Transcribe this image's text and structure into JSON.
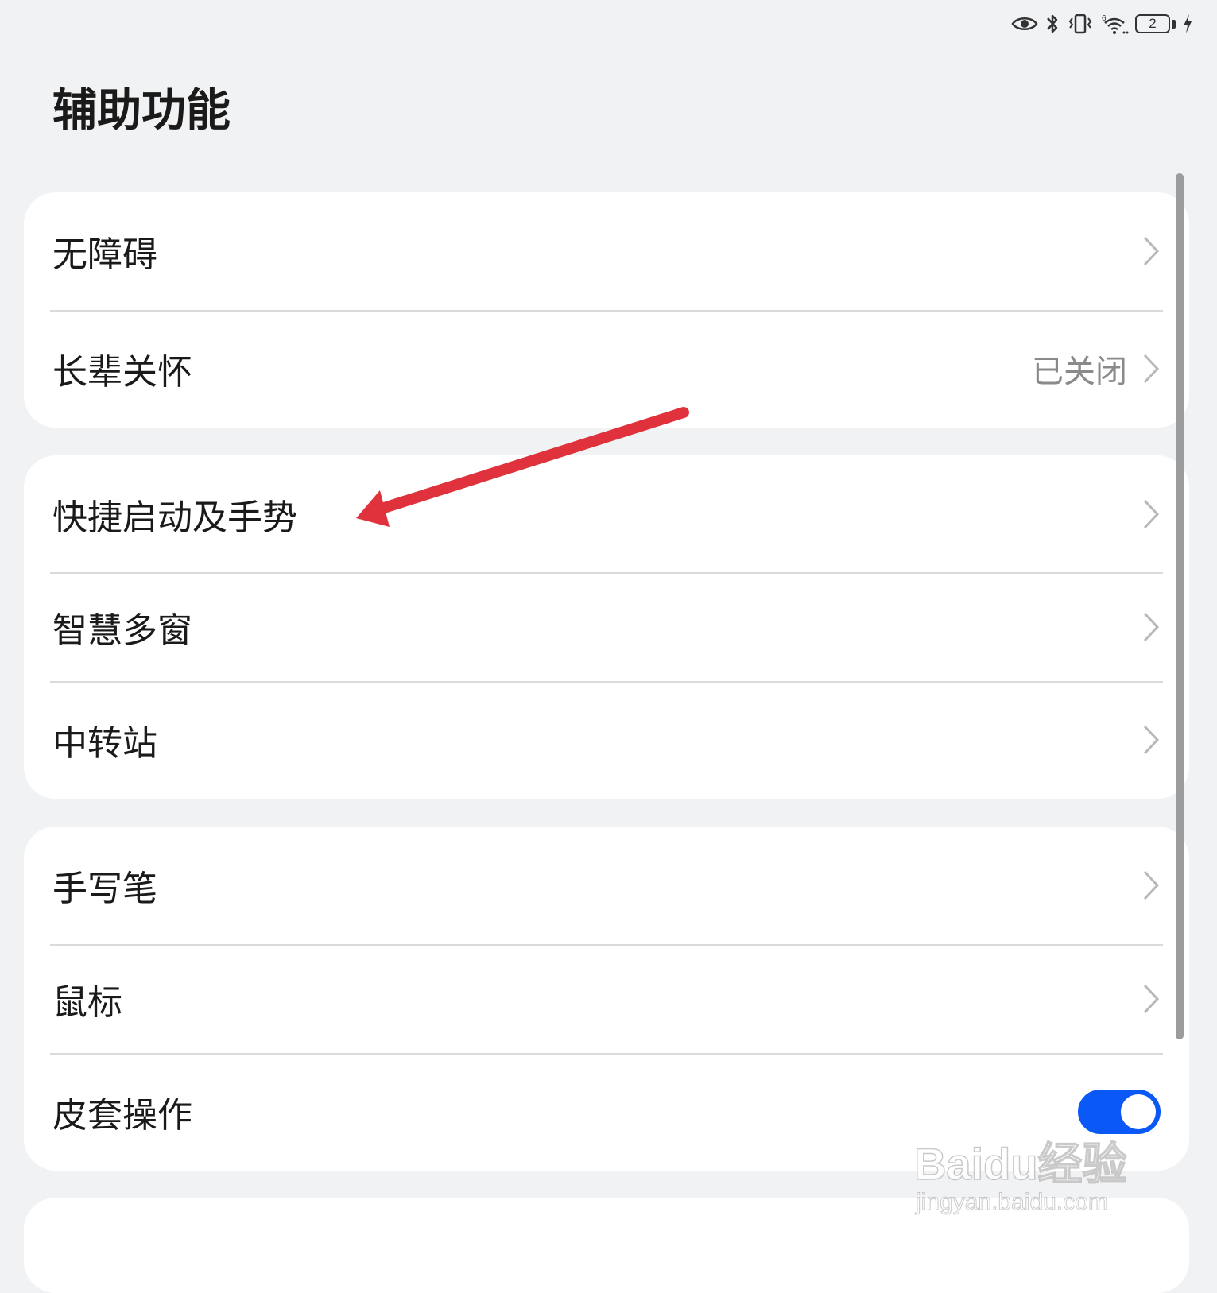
{
  "status_bar": {
    "icons": [
      "eye-icon",
      "bluetooth-icon",
      "vibrate-icon",
      "wifi-6-icon",
      "battery-icon",
      "charging-icon"
    ],
    "battery_level": "2"
  },
  "header": {
    "title": "辅助功能"
  },
  "groups": [
    {
      "items": [
        {
          "label": "无障碍",
          "value": "",
          "control": "chevron"
        },
        {
          "label": "长辈关怀",
          "value": "已关闭",
          "control": "chevron"
        }
      ]
    },
    {
      "items": [
        {
          "label": "快捷启动及手势",
          "value": "",
          "control": "chevron"
        },
        {
          "label": "智慧多窗",
          "value": "",
          "control": "chevron"
        },
        {
          "label": "中转站",
          "value": "",
          "control": "chevron"
        }
      ]
    },
    {
      "items": [
        {
          "label": "手写笔",
          "value": "",
          "control": "chevron"
        },
        {
          "label": "鼠标",
          "value": "",
          "control": "chevron"
        },
        {
          "label": "皮套操作",
          "value": "",
          "control": "toggle",
          "toggle_on": true
        }
      ]
    }
  ],
  "colors": {
    "background": "#f1f2f4",
    "card": "#ffffff",
    "toggle_on": "#0a59f7",
    "annotation_arrow": "#e0323c"
  },
  "watermark": {
    "main": "Baidu经验",
    "sub": "jingyan.baidu.com"
  }
}
